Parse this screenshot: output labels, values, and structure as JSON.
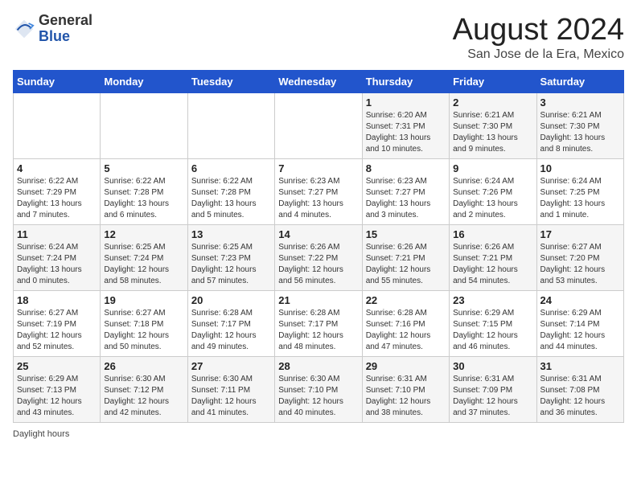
{
  "header": {
    "logo_general": "General",
    "logo_blue": "Blue",
    "month_title": "August 2024",
    "location": "San Jose de la Era, Mexico"
  },
  "days_of_week": [
    "Sunday",
    "Monday",
    "Tuesday",
    "Wednesday",
    "Thursday",
    "Friday",
    "Saturday"
  ],
  "weeks": [
    [
      {
        "day": "",
        "info": ""
      },
      {
        "day": "",
        "info": ""
      },
      {
        "day": "",
        "info": ""
      },
      {
        "day": "",
        "info": ""
      },
      {
        "day": "1",
        "info": "Sunrise: 6:20 AM\nSunset: 7:31 PM\nDaylight: 13 hours\nand 10 minutes."
      },
      {
        "day": "2",
        "info": "Sunrise: 6:21 AM\nSunset: 7:30 PM\nDaylight: 13 hours\nand 9 minutes."
      },
      {
        "day": "3",
        "info": "Sunrise: 6:21 AM\nSunset: 7:30 PM\nDaylight: 13 hours\nand 8 minutes."
      }
    ],
    [
      {
        "day": "4",
        "info": "Sunrise: 6:22 AM\nSunset: 7:29 PM\nDaylight: 13 hours\nand 7 minutes."
      },
      {
        "day": "5",
        "info": "Sunrise: 6:22 AM\nSunset: 7:28 PM\nDaylight: 13 hours\nand 6 minutes."
      },
      {
        "day": "6",
        "info": "Sunrise: 6:22 AM\nSunset: 7:28 PM\nDaylight: 13 hours\nand 5 minutes."
      },
      {
        "day": "7",
        "info": "Sunrise: 6:23 AM\nSunset: 7:27 PM\nDaylight: 13 hours\nand 4 minutes."
      },
      {
        "day": "8",
        "info": "Sunrise: 6:23 AM\nSunset: 7:27 PM\nDaylight: 13 hours\nand 3 minutes."
      },
      {
        "day": "9",
        "info": "Sunrise: 6:24 AM\nSunset: 7:26 PM\nDaylight: 13 hours\nand 2 minutes."
      },
      {
        "day": "10",
        "info": "Sunrise: 6:24 AM\nSunset: 7:25 PM\nDaylight: 13 hours\nand 1 minute."
      }
    ],
    [
      {
        "day": "11",
        "info": "Sunrise: 6:24 AM\nSunset: 7:24 PM\nDaylight: 13 hours\nand 0 minutes."
      },
      {
        "day": "12",
        "info": "Sunrise: 6:25 AM\nSunset: 7:24 PM\nDaylight: 12 hours\nand 58 minutes."
      },
      {
        "day": "13",
        "info": "Sunrise: 6:25 AM\nSunset: 7:23 PM\nDaylight: 12 hours\nand 57 minutes."
      },
      {
        "day": "14",
        "info": "Sunrise: 6:26 AM\nSunset: 7:22 PM\nDaylight: 12 hours\nand 56 minutes."
      },
      {
        "day": "15",
        "info": "Sunrise: 6:26 AM\nSunset: 7:21 PM\nDaylight: 12 hours\nand 55 minutes."
      },
      {
        "day": "16",
        "info": "Sunrise: 6:26 AM\nSunset: 7:21 PM\nDaylight: 12 hours\nand 54 minutes."
      },
      {
        "day": "17",
        "info": "Sunrise: 6:27 AM\nSunset: 7:20 PM\nDaylight: 12 hours\nand 53 minutes."
      }
    ],
    [
      {
        "day": "18",
        "info": "Sunrise: 6:27 AM\nSunset: 7:19 PM\nDaylight: 12 hours\nand 52 minutes."
      },
      {
        "day": "19",
        "info": "Sunrise: 6:27 AM\nSunset: 7:18 PM\nDaylight: 12 hours\nand 50 minutes."
      },
      {
        "day": "20",
        "info": "Sunrise: 6:28 AM\nSunset: 7:17 PM\nDaylight: 12 hours\nand 49 minutes."
      },
      {
        "day": "21",
        "info": "Sunrise: 6:28 AM\nSunset: 7:17 PM\nDaylight: 12 hours\nand 48 minutes."
      },
      {
        "day": "22",
        "info": "Sunrise: 6:28 AM\nSunset: 7:16 PM\nDaylight: 12 hours\nand 47 minutes."
      },
      {
        "day": "23",
        "info": "Sunrise: 6:29 AM\nSunset: 7:15 PM\nDaylight: 12 hours\nand 46 minutes."
      },
      {
        "day": "24",
        "info": "Sunrise: 6:29 AM\nSunset: 7:14 PM\nDaylight: 12 hours\nand 44 minutes."
      }
    ],
    [
      {
        "day": "25",
        "info": "Sunrise: 6:29 AM\nSunset: 7:13 PM\nDaylight: 12 hours\nand 43 minutes."
      },
      {
        "day": "26",
        "info": "Sunrise: 6:30 AM\nSunset: 7:12 PM\nDaylight: 12 hours\nand 42 minutes."
      },
      {
        "day": "27",
        "info": "Sunrise: 6:30 AM\nSunset: 7:11 PM\nDaylight: 12 hours\nand 41 minutes."
      },
      {
        "day": "28",
        "info": "Sunrise: 6:30 AM\nSunset: 7:10 PM\nDaylight: 12 hours\nand 40 minutes."
      },
      {
        "day": "29",
        "info": "Sunrise: 6:31 AM\nSunset: 7:10 PM\nDaylight: 12 hours\nand 38 minutes."
      },
      {
        "day": "30",
        "info": "Sunrise: 6:31 AM\nSunset: 7:09 PM\nDaylight: 12 hours\nand 37 minutes."
      },
      {
        "day": "31",
        "info": "Sunrise: 6:31 AM\nSunset: 7:08 PM\nDaylight: 12 hours\nand 36 minutes."
      }
    ]
  ],
  "legend": {
    "daylight_hours": "Daylight hours"
  }
}
